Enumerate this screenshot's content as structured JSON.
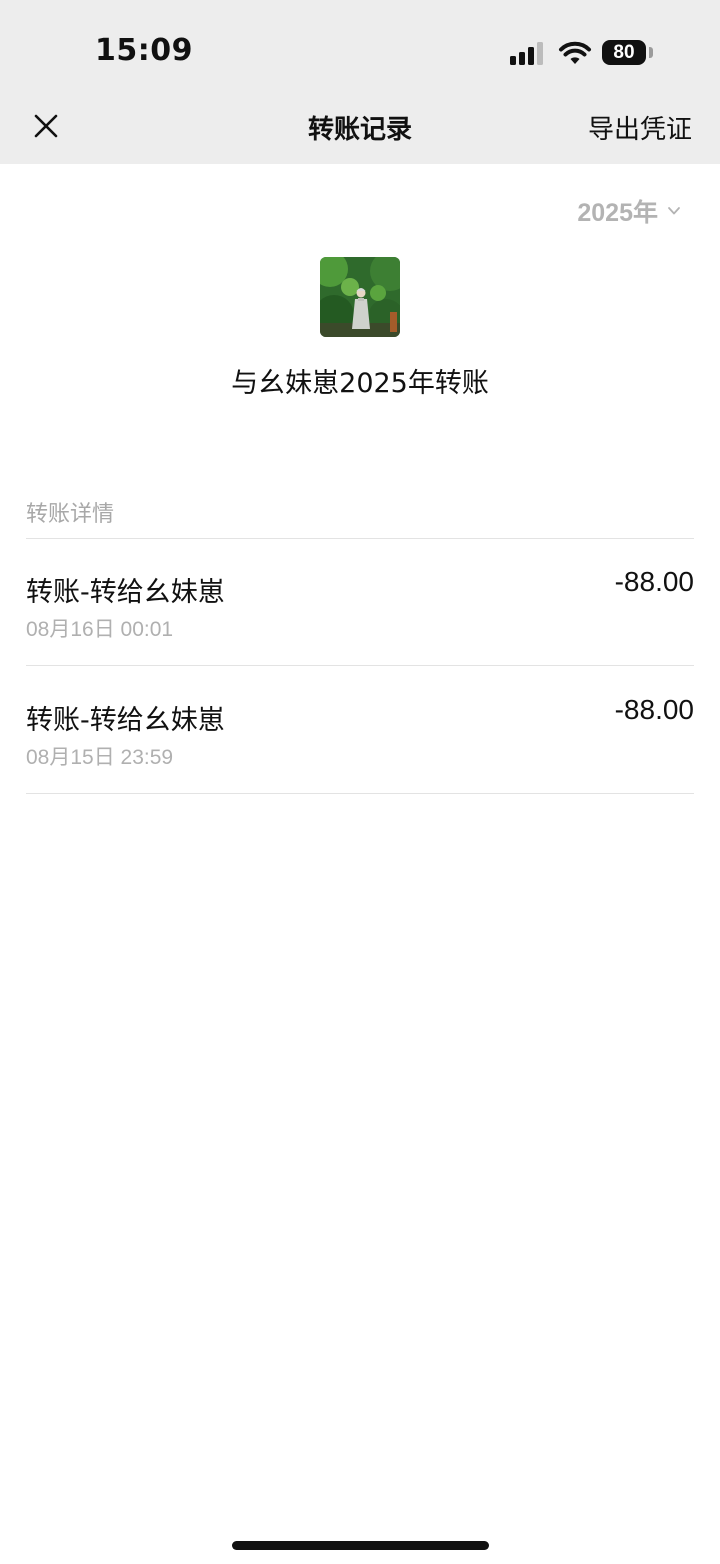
{
  "status_bar": {
    "time": "15:09",
    "battery": "80"
  },
  "nav": {
    "title": "转账记录",
    "export_label": "导出凭证"
  },
  "filter": {
    "year": "2025年"
  },
  "header": {
    "title": "与幺妹崽2025年转账"
  },
  "section": {
    "label": "转账详情"
  },
  "transactions": [
    {
      "title": "转账-转给幺妹崽",
      "date": "08月16日 00:01",
      "amount": "-88.00"
    },
    {
      "title": "转账-转给幺妹崽",
      "date": "08月15日 23:59",
      "amount": "-88.00"
    }
  ]
}
